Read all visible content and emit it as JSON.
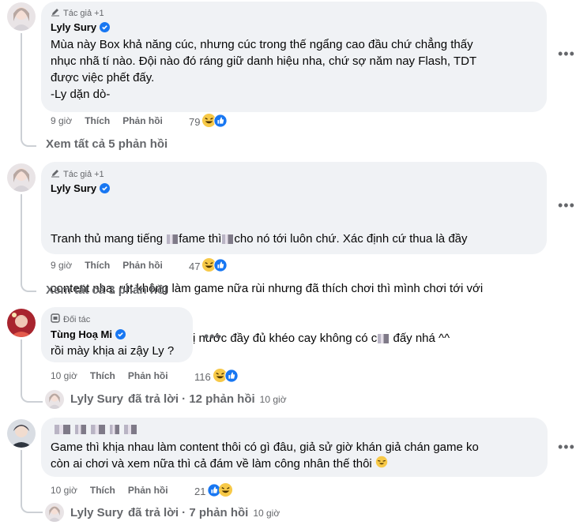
{
  "comments": [
    {
      "badge": "Tác giả +1",
      "author": "Lyly Sury",
      "text": "Mùa này Box khả năng cúc, nhưng cúc trong thế ngẩng cao đầu chứ chẳng thấy\nnhục nhã tí nào. Đội nào đó ráng giữ danh hiệu nha, chứ sợ năm nay Flash, TDT\nđược việc phết đấy.\n-Ly dặn dò-",
      "time": "9 giờ",
      "like": "Thích",
      "reply": "Phản hồi",
      "reactions": "79",
      "view_more": "Xem tất cả 5 phản hồi"
    },
    {
      "badge": "Tác giả +1",
      "author": "Lyly Sury",
      "text_l1a": "Tranh thủ mang tiếng",
      "text_l1b": "fame thì",
      "text_l1c": "cho nó tới luôn chứ. Xác định cứ thua là đầy",
      "text_l2": "content nha, rút không làm game nữa rùi nhưng đã thích chơi thì mình chơi tới với",
      "text_l3a": "các bạn luôn. Nhớ chuẩn bị nước đầy đủ khéo cay không có c",
      "text_l3b": "đấy nhá ^^",
      "time": "9 giờ",
      "like": "Thích",
      "reply": "Phản hồi",
      "reactions": "47",
      "view_more": "Xem tất cả 3 phản hồi"
    },
    {
      "badge": "Đối tác",
      "author": "Tùng Hoạ Mi",
      "text": "rồi mày khịa ai zậy Ly ?",
      "time": "10 giờ",
      "like": "Thích",
      "reply": "Phản hồi",
      "reactions": "116",
      "reply_summary": {
        "name": "Lyly Sury",
        "action": "đã trả lời · 12 phản hồi",
        "time": "10 giờ"
      }
    },
    {
      "author": "",
      "text": "Game thì khịa nhau làm content thôi có gì đâu, giả sử giờ khán giả chán game ko\ncòn ai chơi và xem nữa thì cả đám về làm công nhân thế thôi",
      "time": "10 giờ",
      "like": "Thích",
      "reply": "Phản hồi",
      "reactions": "21",
      "reply_summary": {
        "name": "Lyly Sury",
        "action": "đã trả lời · 7 phản hồi",
        "time": "10 giờ"
      }
    }
  ],
  "more_icon_glyph": "•••",
  "colors": {
    "blue": "#1877f2",
    "bubble": "#f0f2f5",
    "grey": "#65676b",
    "line": "#ccd0d5"
  }
}
